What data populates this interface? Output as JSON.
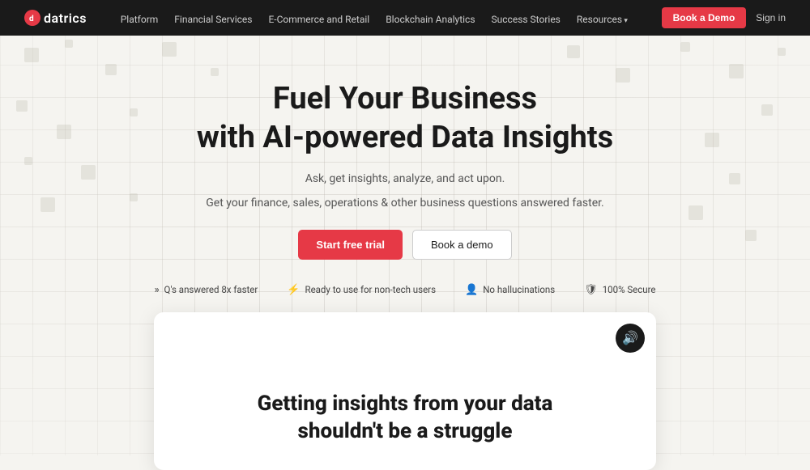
{
  "nav": {
    "logo_text": "datrics",
    "logo_icon": "d",
    "links": [
      {
        "label": "Platform",
        "has_dropdown": false
      },
      {
        "label": "Financial Services",
        "has_dropdown": false
      },
      {
        "label": "E-Commerce and Retail",
        "has_dropdown": false
      },
      {
        "label": "Blockchain Analytics",
        "has_dropdown": false
      },
      {
        "label": "Success Stories",
        "has_dropdown": false
      },
      {
        "label": "Resources",
        "has_dropdown": true
      }
    ],
    "book_demo_label": "Book a Demo",
    "signin_label": "Sign in"
  },
  "hero": {
    "headline_line1": "Fuel Your Business",
    "headline_line2": "with AI-powered Data Insights",
    "subtext_line1": "Ask, get insights, analyze, and act upon.",
    "subtext_line2": "Get your finance, sales, operations & other business questions answered faster.",
    "cta_trial": "Start free trial",
    "cta_demo": "Book a demo"
  },
  "badges": [
    {
      "icon": "»",
      "label": "Q's answered 8x faster"
    },
    {
      "icon": "⚡",
      "label": "Ready to use for non-tech users"
    },
    {
      "icon": "👤",
      "label": "No hallucinations"
    },
    {
      "icon": "🛡",
      "label": "100% Secure"
    }
  ],
  "video_card": {
    "heading_line1": "Getting insights from your data",
    "heading_line2": "shouldn't be a struggle",
    "sound_icon": "🔊"
  }
}
